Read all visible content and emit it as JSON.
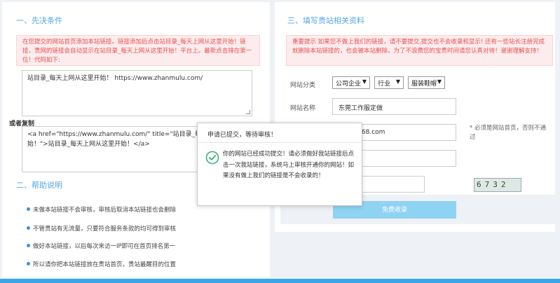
{
  "left": {
    "section1_title": "一、先决条件",
    "notice": "在您提交的网站首页添加本站链接。链接添加后点击站目录_每天上网从这里开始！链接，贵网的链接会自动显示在站目录_每天上网从这里开始！平台上。最新点击排在第一位！代码如下:",
    "code1": "站目录_每天上网从这里开始！   https://www.zhanmulu.com/",
    "or_copy_label": "或者复制",
    "code2": "<a href=\"https://www.zhanmulu.com/\" title=\"站目录_每天上网从这里开始！\">站目录_每天上网从这里开始！</a>",
    "section2_title": "二、帮助说明",
    "help_items": [
      "未做本站链接不会审核，审核后取消本站链接也会删除",
      "不管贵站有无流量，只要符合服务条款的均可得到审核",
      "做好本站链接，以后每次来访一IP即可在首页排名第一",
      "所以请你把本站链接放在贵站首页，贵站最醒目的位置"
    ]
  },
  "right": {
    "section3_title": "三、填写贵站相关资料",
    "notice": "重要提示 如果您不做上我们的链接，请不要提交,提交也不会收录和显示! 还有一些站长注册完成就删除本站链接的，也会被本站删除，为了不浪费您的宝贵时间请您认真对待！谢谢理解支持！",
    "category_label": "网站分类",
    "select1": "公司企业",
    "select2": "行业",
    "select3": "服装鞋帽",
    "name_label": "网站名称",
    "name_value": "东莞工作服定做",
    "url_value": "w.wlfz168.com",
    "url_hint": "* 必须是网站首页，否则不通过",
    "captcha_text": "6732",
    "submit_label": "免费收录"
  },
  "modal": {
    "title": "申请已提交，等待审核！",
    "message": "你的网站已经成功提交！请必须做好我站链接后点击一次我站链接，系统马上审核开通你的网站！如果没有做上我们的链接是不会收录的！"
  },
  "colors": {
    "accent": "#55a6e6",
    "notice_text": "#e85050",
    "notice_bg": "#fdeced",
    "submit_bg": "#8fd3f3",
    "success_icon": "#3bb07a"
  }
}
